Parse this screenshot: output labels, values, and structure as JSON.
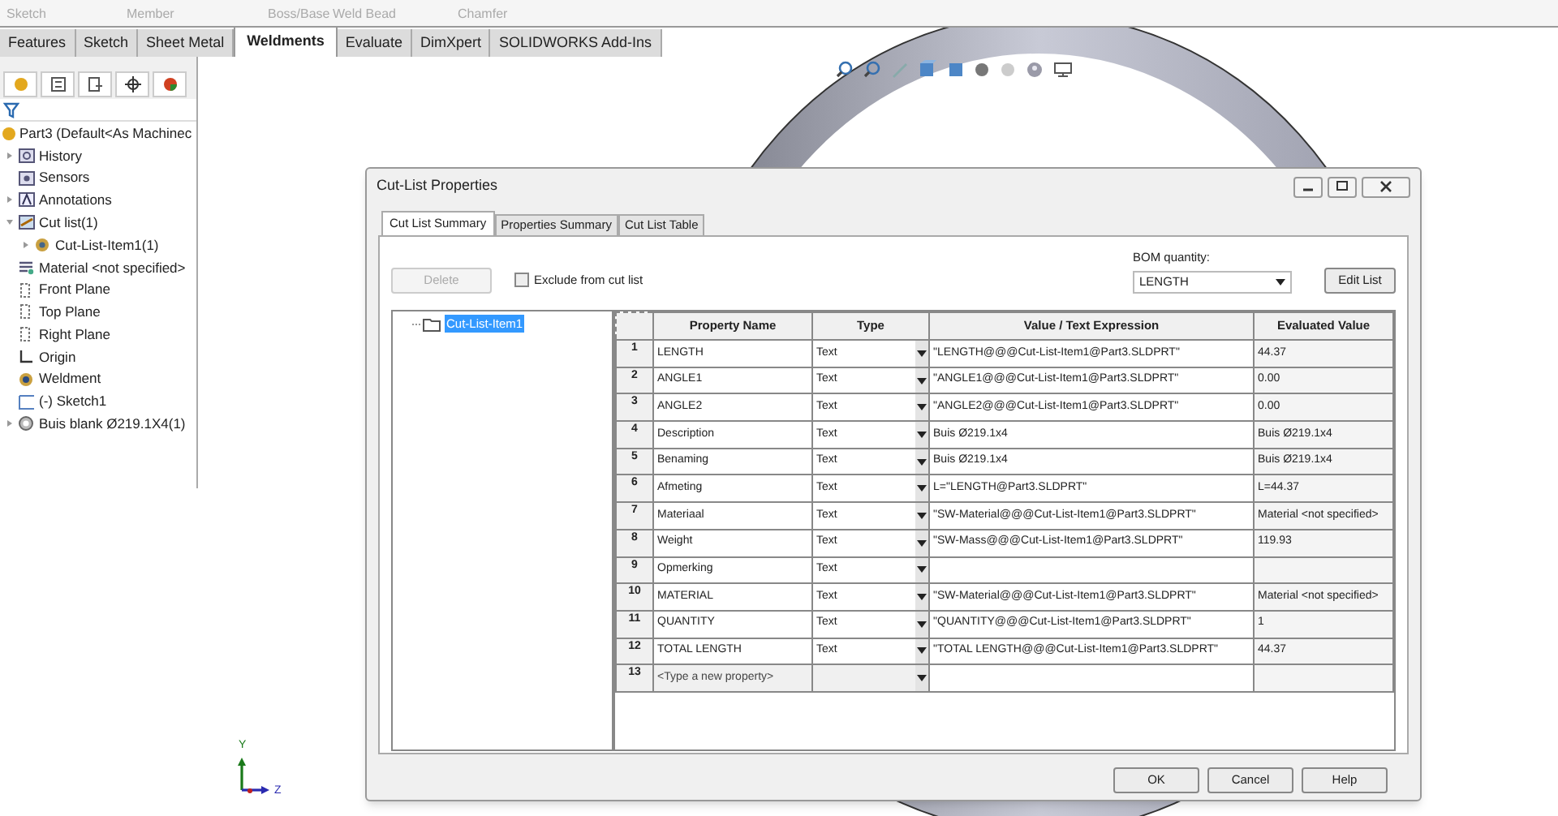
{
  "ribbon": {
    "commands": [
      {
        "label": "Sketch"
      },
      {
        "label": "Member"
      },
      {
        "label": "Boss/Base"
      },
      {
        "label": "Weld Bead"
      },
      {
        "label": "Chamfer"
      }
    ]
  },
  "command_tabs": [
    {
      "label": "Features",
      "selected": false
    },
    {
      "label": "Sketch",
      "selected": false
    },
    {
      "label": "Sheet Metal",
      "selected": false
    },
    {
      "label": "Weldments",
      "selected": true
    },
    {
      "label": "Evaluate",
      "selected": false
    },
    {
      "label": "DimXpert",
      "selected": false
    },
    {
      "label": "SOLIDWORKS Add-Ins",
      "selected": false
    }
  ],
  "feature_tree": {
    "root": "Part3  (Default<As Machinec",
    "items": [
      {
        "label": "History",
        "kind": "history",
        "expanded": false
      },
      {
        "label": "Sensors",
        "kind": "sensors"
      },
      {
        "label": "Annotations",
        "kind": "annotations",
        "expanded": false
      },
      {
        "label": "Cut list(1)",
        "kind": "cutlist",
        "expanded": true,
        "children": [
          {
            "label": "Cut-List-Item1(1)",
            "kind": "cutitem",
            "expanded": false
          }
        ]
      },
      {
        "label": "Material <not specified>",
        "kind": "material"
      },
      {
        "label": "Front Plane",
        "kind": "plane"
      },
      {
        "label": "Top Plane",
        "kind": "plane"
      },
      {
        "label": "Right Plane",
        "kind": "plane"
      },
      {
        "label": "Origin",
        "kind": "origin"
      },
      {
        "label": "Weldment",
        "kind": "weldment"
      },
      {
        "label": "(-) Sketch1",
        "kind": "sketch"
      },
      {
        "label": "Buis blank Ø219.1X4(1)",
        "kind": "body",
        "expanded": false
      }
    ]
  },
  "triad": {
    "labels": [
      "Y",
      "Z"
    ]
  },
  "dialog": {
    "title": "Cut-List Properties",
    "tabs": [
      {
        "label": "Cut List Summary",
        "selected": true
      },
      {
        "label": "Properties Summary",
        "selected": false
      },
      {
        "label": "Cut List Table",
        "selected": false
      }
    ],
    "delete_button": {
      "label": "Delete",
      "disabled": true
    },
    "exclude_checkbox": {
      "label": "Exclude from cut list",
      "checked": false
    },
    "bom_quantity": {
      "label": "BOM quantity:",
      "value": "LENGTH"
    },
    "edit_list_button": "Edit List",
    "tree_item": {
      "label": "Cut-List-Item1",
      "selected": true
    },
    "table": {
      "columns": [
        "Property Name",
        "Type",
        "Value / Text Expression",
        "Evaluated Value"
      ],
      "rows": [
        {
          "number": "1",
          "name": "LENGTH",
          "type": "Text",
          "value": "\"LENGTH@@@Cut-List-Item1@Part3.SLDPRT\"",
          "evaluated": "44.37",
          "kind": "property"
        },
        {
          "number": "2",
          "name": "ANGLE1",
          "type": "Text",
          "value": "\"ANGLE1@@@Cut-List-Item1@Part3.SLDPRT\"",
          "evaluated": "0.00",
          "kind": "property"
        },
        {
          "number": "3",
          "name": "ANGLE2",
          "type": "Text",
          "value": "\"ANGLE2@@@Cut-List-Item1@Part3.SLDPRT\"",
          "evaluated": "0.00",
          "kind": "property"
        },
        {
          "number": "4",
          "name": "Description",
          "type": "Text",
          "value": "Buis Ø219.1x4",
          "evaluated": "Buis Ø219.1x4",
          "kind": "property"
        },
        {
          "number": "5",
          "name": "Benaming",
          "type": "Text",
          "value": "Buis Ø219.1x4",
          "evaluated": "Buis Ø219.1x4",
          "kind": "property"
        },
        {
          "number": "6",
          "name": "Afmeting",
          "type": "Text",
          "value": "L=\"LENGTH@Part3.SLDPRT\"",
          "evaluated": "L=44.37",
          "kind": "property"
        },
        {
          "number": "7",
          "name": "Materiaal",
          "type": "Text",
          "value": "\"SW-Material@@@Cut-List-Item1@Part3.SLDPRT\"",
          "evaluated": "Material <not specified>",
          "kind": "property"
        },
        {
          "number": "8",
          "name": "Weight",
          "type": "Text",
          "value": "\"SW-Mass@@@Cut-List-Item1@Part3.SLDPRT\"",
          "evaluated": "119.93",
          "kind": "property"
        },
        {
          "number": "9",
          "name": "Opmerking",
          "type": "Text",
          "kind": "property"
        },
        {
          "number": "10",
          "name": "MATERIAL",
          "type": "Text",
          "value": "\"SW-Material@@@Cut-List-Item1@Part3.SLDPRT\"",
          "evaluated": "Material <not specified>",
          "kind": "property"
        },
        {
          "number": "11",
          "name": "QUANTITY",
          "type": "Text",
          "value": "\"QUANTITY@@@Cut-List-Item1@Part3.SLDPRT\"",
          "evaluated": "1",
          "kind": "property"
        },
        {
          "number": "12",
          "name": "TOTAL LENGTH",
          "type": "Text",
          "value": "\"TOTAL LENGTH@@@Cut-List-Item1@Part3.SLDPRT\"",
          "evaluated": "44.37",
          "kind": "property"
        },
        {
          "number": "13",
          "name": "<Type a new property>",
          "kind": "new"
        }
      ]
    },
    "buttons": [
      "OK",
      "Cancel",
      "Help"
    ]
  }
}
